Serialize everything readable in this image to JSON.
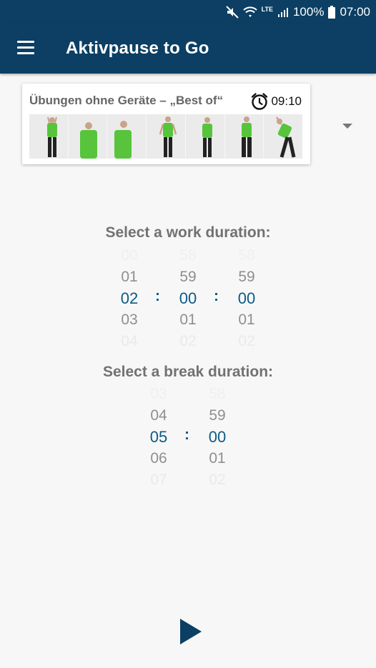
{
  "status_bar": {
    "icons": [
      "mute-icon",
      "wifi-icon",
      "lte-icon",
      "signal-icon",
      "battery-icon"
    ],
    "network": "LTE",
    "battery": "100%",
    "time": "07:00"
  },
  "app_bar": {
    "title": "Aktivpause to Go",
    "menu_icon": "menu-icon"
  },
  "program_card": {
    "title": "Übungen ohne Geräte – „Best of“",
    "duration": "09:10",
    "thumbnail_count": 7
  },
  "work": {
    "label": "Select a work duration:",
    "hours": [
      "00",
      "01",
      "02",
      "03",
      "04"
    ],
    "minutes": [
      "58",
      "59",
      "00",
      "01",
      "02"
    ],
    "seconds": [
      "58",
      "59",
      "00",
      "01",
      "02"
    ],
    "separator": ":"
  },
  "break": {
    "label": "Select a break duration:",
    "minutes": [
      "03",
      "04",
      "05",
      "06",
      "07"
    ],
    "seconds": [
      "58",
      "59",
      "00",
      "01",
      "02"
    ],
    "separator": ":"
  },
  "colors": {
    "primary": "#0c3f63",
    "selected_value": "#0b5a86",
    "background": "#f7f7f7",
    "shirt": "#57c43c"
  },
  "play_icon": "play-icon"
}
